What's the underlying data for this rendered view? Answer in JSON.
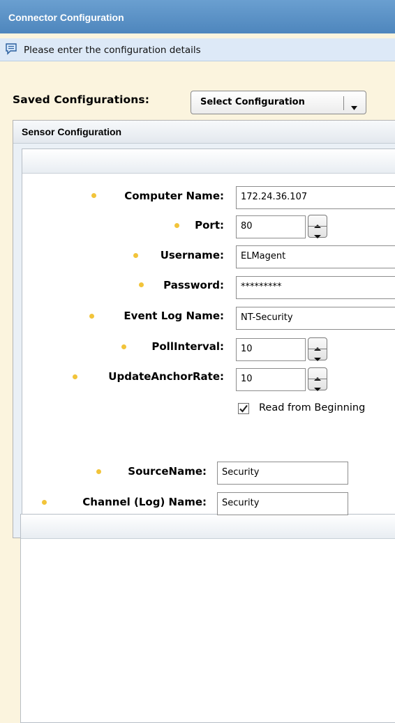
{
  "window": {
    "title": "Connector Configuration"
  },
  "info_bar": {
    "icon": "message-icon",
    "message": "Please enter the configuration details"
  },
  "saved_configurations": {
    "label": "Saved Configurations:",
    "selected": "Select Configuration"
  },
  "sensor_configuration": {
    "title": "Sensor Configuration",
    "fields": {
      "computer_name": {
        "label": "Computer Name:",
        "value": "172.24.36.107"
      },
      "port": {
        "label": "Port:",
        "value": "80"
      },
      "username": {
        "label": "Username:",
        "value": "ELMagent"
      },
      "password": {
        "label": "Password:",
        "value": "*********"
      },
      "event_log_name": {
        "label": "Event Log Name:",
        "value": "NT-Security"
      },
      "poll_interval": {
        "label": "PollInterval:",
        "value": "10"
      },
      "update_anchor_rate": {
        "label": "UpdateAnchorRate:",
        "value": "10"
      }
    },
    "read_from_beginning": {
      "label": "Read from Beginning",
      "checked": true
    },
    "source": {
      "source_name": {
        "label": "SourceName:",
        "value": "Security"
      },
      "channel_name": {
        "label": "Channel (Log) Name:",
        "value": "Security"
      }
    }
  },
  "colors": {
    "title_bar": "#5a93c8",
    "info_bar": "#dde9f7",
    "background": "#fbf4de",
    "required_dot": "#f2c43a"
  }
}
